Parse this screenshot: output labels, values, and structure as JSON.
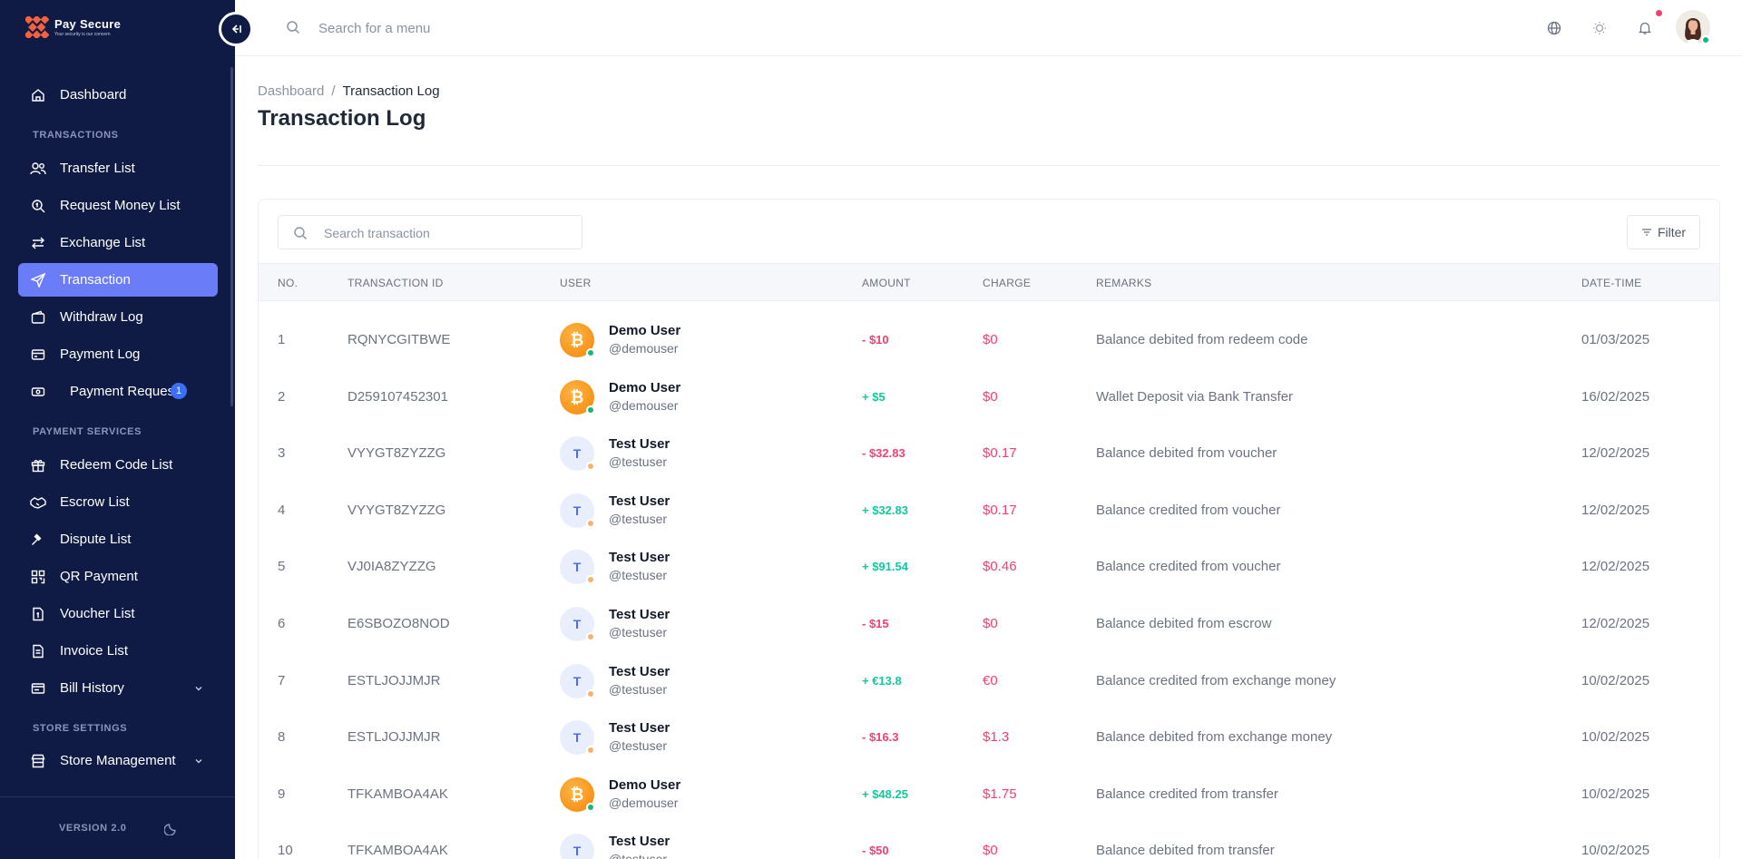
{
  "brand": {
    "name": "Pay Secure",
    "tagline": "Your security is our concern"
  },
  "colors": {
    "sidebar": "#0f1b45",
    "active": "#6a7cf7",
    "debit": "#f43f6e",
    "credit": "#10c9a0",
    "badge": "#3b6ff5"
  },
  "sidebar": {
    "dashboard": "Dashboard",
    "sections": {
      "transactions": "TRANSACTIONS",
      "payment_services": "PAYMENT SERVICES",
      "store_settings": "STORE SETTINGS"
    },
    "items": {
      "transfer_list": "Transfer List",
      "request_money_list": "Request Money List",
      "exchange_list": "Exchange List",
      "transaction": "Transaction",
      "withdraw_log": "Withdraw Log",
      "payment_log": "Payment Log",
      "payment_request": "Payment Request",
      "payment_request_badge": "1",
      "redeem_code_list": "Redeem Code List",
      "escrow_list": "Escrow List",
      "dispute_list": "Dispute List",
      "qr_payment": "QR Payment",
      "voucher_list": "Voucher List",
      "invoice_list": "Invoice List",
      "bill_history": "Bill History",
      "store_management": "Store Management"
    },
    "version": "VERSION 2.0"
  },
  "topbar": {
    "search_placeholder": "Search for a menu",
    "icons": [
      "globe-icon",
      "sun-icon",
      "bell-icon"
    ]
  },
  "breadcrumb": {
    "home": "Dashboard",
    "separator": "/",
    "current": "Transaction Log"
  },
  "page_title": "Transaction Log",
  "table": {
    "search_placeholder": "Search transaction",
    "filter_label": "Filter",
    "headers": {
      "no": "NO.",
      "transaction_id": "TRANSACTION ID",
      "user": "USER",
      "amount": "AMOUNT",
      "charge": "CHARGE",
      "remarks": "REMARKS",
      "datetime": "DATE-TIME"
    },
    "rows": [
      {
        "no": "1",
        "tx_id": "RQNYCGITBWE",
        "avatar": "bitcoin",
        "initial": "",
        "name": "Demo User",
        "handle": "@demouser",
        "amount": "- $10",
        "type": "debit",
        "charge": "$0",
        "remarks": "Balance debited from redeem code",
        "date": "01/03/2025"
      },
      {
        "no": "2",
        "tx_id": "D259107452301",
        "avatar": "bitcoin",
        "initial": "",
        "name": "Demo User",
        "handle": "@demouser",
        "amount": "+ $5",
        "type": "credit",
        "charge": "$0",
        "remarks": "Wallet Deposit via Bank Transfer",
        "date": "16/02/2025"
      },
      {
        "no": "3",
        "tx_id": "VYYGT8ZYZZG",
        "avatar": "initial",
        "initial": "T",
        "name": "Test User",
        "handle": "@testuser",
        "amount": "- $32.83",
        "type": "debit",
        "charge": "$0.17",
        "remarks": "Balance debited from voucher",
        "date": "12/02/2025"
      },
      {
        "no": "4",
        "tx_id": "VYYGT8ZYZZG",
        "avatar": "initial",
        "initial": "T",
        "name": "Test User",
        "handle": "@testuser",
        "amount": "+ $32.83",
        "type": "credit",
        "charge": "$0.17",
        "remarks": "Balance credited from voucher",
        "date": "12/02/2025"
      },
      {
        "no": "5",
        "tx_id": "VJ0IA8ZYZZG",
        "avatar": "initial",
        "initial": "T",
        "name": "Test User",
        "handle": "@testuser",
        "amount": "+ $91.54",
        "type": "credit",
        "charge": "$0.46",
        "remarks": "Balance credited from voucher",
        "date": "12/02/2025"
      },
      {
        "no": "6",
        "tx_id": "E6SBOZO8NOD",
        "avatar": "initial",
        "initial": "T",
        "name": "Test User",
        "handle": "@testuser",
        "amount": "- $15",
        "type": "debit",
        "charge": "$0",
        "remarks": "Balance debited from escrow",
        "date": "12/02/2025"
      },
      {
        "no": "7",
        "tx_id": "ESTLJOJJMJR",
        "avatar": "initial",
        "initial": "T",
        "name": "Test User",
        "handle": "@testuser",
        "amount": "+ €13.8",
        "type": "credit",
        "charge": "€0",
        "remarks": "Balance credited from exchange money",
        "date": "10/02/2025"
      },
      {
        "no": "8",
        "tx_id": "ESTLJOJJMJR",
        "avatar": "initial",
        "initial": "T",
        "name": "Test User",
        "handle": "@testuser",
        "amount": "- $16.3",
        "type": "debit",
        "charge": "$1.3",
        "remarks": "Balance debited from exchange money",
        "date": "10/02/2025"
      },
      {
        "no": "9",
        "tx_id": "TFKAMBOA4AK",
        "avatar": "bitcoin",
        "initial": "",
        "name": "Demo User",
        "handle": "@demouser",
        "amount": "+ $48.25",
        "type": "credit",
        "charge": "$1.75",
        "remarks": "Balance credited from transfer",
        "date": "10/02/2025"
      },
      {
        "no": "10",
        "tx_id": "TFKAMBOA4AK",
        "avatar": "initial",
        "initial": "T",
        "name": "Test User",
        "handle": "@testuser",
        "amount": "- $50",
        "type": "debit",
        "charge": "$0",
        "remarks": "Balance debited from transfer",
        "date": "10/02/2025"
      }
    ]
  }
}
